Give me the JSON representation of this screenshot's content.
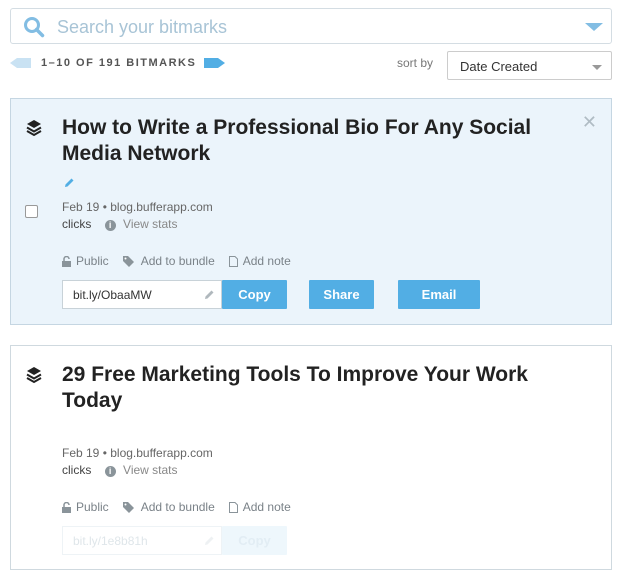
{
  "search": {
    "placeholder": "Search your bitmarks"
  },
  "pager": {
    "count_text": "1–10 OF 191 BITMARKS"
  },
  "sort": {
    "label": "sort by",
    "selected": "Date Created"
  },
  "cards": [
    {
      "title": "How to Write a Professional Bio For Any Social Media Network",
      "date": "Feb 19",
      "domain": "blog.bufferapp.com",
      "clicks_label": "clicks",
      "view_stats": "View stats",
      "public_label": "Public",
      "bundle_label": "Add to bundle",
      "note_label": "Add note",
      "short_url": "bit.ly/ObaaMW",
      "copy_label": "Copy",
      "share_label": "Share",
      "email_label": "Email"
    },
    {
      "title": "29 Free Marketing Tools To Improve Your Work Today",
      "date": "Feb 19",
      "domain": "blog.bufferapp.com",
      "clicks_label": "clicks",
      "view_stats": "View stats",
      "public_label": "Public",
      "bundle_label": "Add to bundle",
      "note_label": "Add note",
      "short_url": "bit.ly/1e8b81h",
      "copy_label": "Copy"
    }
  ],
  "colors": {
    "accent": "#52aee4",
    "selected_bg": "#ebf4fb",
    "search_text": "#a8c4d6"
  }
}
